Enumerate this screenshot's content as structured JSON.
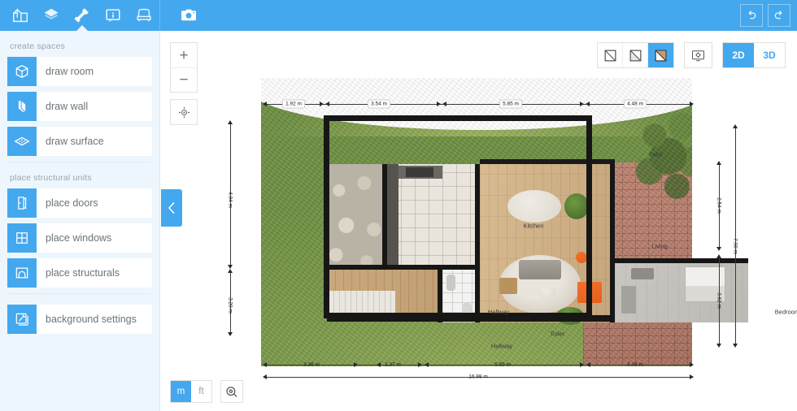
{
  "app": {
    "topbar": {
      "nav_icons": [
        {
          "name": "building-3d-icon",
          "label": "building"
        },
        {
          "name": "layers-icon",
          "label": "layers"
        },
        {
          "name": "hammer-tools-icon",
          "label": "tools"
        },
        {
          "name": "info-panel-icon",
          "label": "info"
        },
        {
          "name": "furniture-chair-icon",
          "label": "furniture"
        }
      ],
      "active_index": 2,
      "camera_label": "camera-icon",
      "undo_label": "undo-icon",
      "redo_label": "redo-icon"
    },
    "sidebar": {
      "sections": [
        {
          "title": "create spaces",
          "items": [
            {
              "label": "draw room",
              "icon": "draw-room-icon"
            },
            {
              "label": "draw wall",
              "icon": "draw-wall-icon"
            },
            {
              "label": "draw surface",
              "icon": "draw-surface-icon"
            }
          ]
        },
        {
          "title": "place structural units",
          "items": [
            {
              "label": "place doors",
              "icon": "door-icon"
            },
            {
              "label": "place windows",
              "icon": "window-icon"
            },
            {
              "label": "place structurals",
              "icon": "fireplace-icon"
            }
          ]
        },
        {
          "title": "",
          "items": [
            {
              "label": "background settings",
              "icon": "background-settings-icon"
            }
          ]
        }
      ]
    },
    "canvas": {
      "zoom_in": "+",
      "zoom_out": "−",
      "locate": "center-view-icon",
      "collapse": "collapse-sidebar-icon",
      "view_modes": [
        {
          "name": "wall-outline-mode",
          "selected": false
        },
        {
          "name": "wall-light-fill-mode",
          "selected": false
        },
        {
          "name": "wall-texture-fill-mode",
          "selected": true
        }
      ],
      "display_settings": {
        "name": "display-settings-icon"
      },
      "dimension_toggle": [
        {
          "label": "2D",
          "selected": true
        },
        {
          "label": "3D",
          "selected": false
        }
      ],
      "units": [
        {
          "label": "m",
          "selected": true
        },
        {
          "label": "ft",
          "selected": false
        }
      ],
      "measure_tool": "measuring-tape-icon"
    },
    "plan": {
      "room_labels": [
        {
          "label": "Patio"
        },
        {
          "label": "Kitchen"
        },
        {
          "label": "Living"
        },
        {
          "label": "Hallway"
        },
        {
          "label": "Hallway"
        },
        {
          "label": "Toilet"
        },
        {
          "label": "Bedroom"
        }
      ],
      "dimensions": {
        "top": [
          "1.92 m",
          "3.54 m",
          "5.85 m",
          "4.48 m"
        ],
        "bottom": [
          "3.36 m",
          "1.37 m",
          "5.85 m",
          "4.48 m"
        ],
        "bottom_total": "16.98 m",
        "left": [
          "4.04 m",
          "3.20 m"
        ],
        "right": [
          "2.54 m",
          "3.62 m"
        ],
        "right_total": "7.90 m"
      }
    },
    "colors": {
      "accent": "#44a8ee",
      "sidebar_bg": "#eef6fd",
      "panel_text": "#6b7479",
      "section_text": "#9aa4ac"
    }
  }
}
